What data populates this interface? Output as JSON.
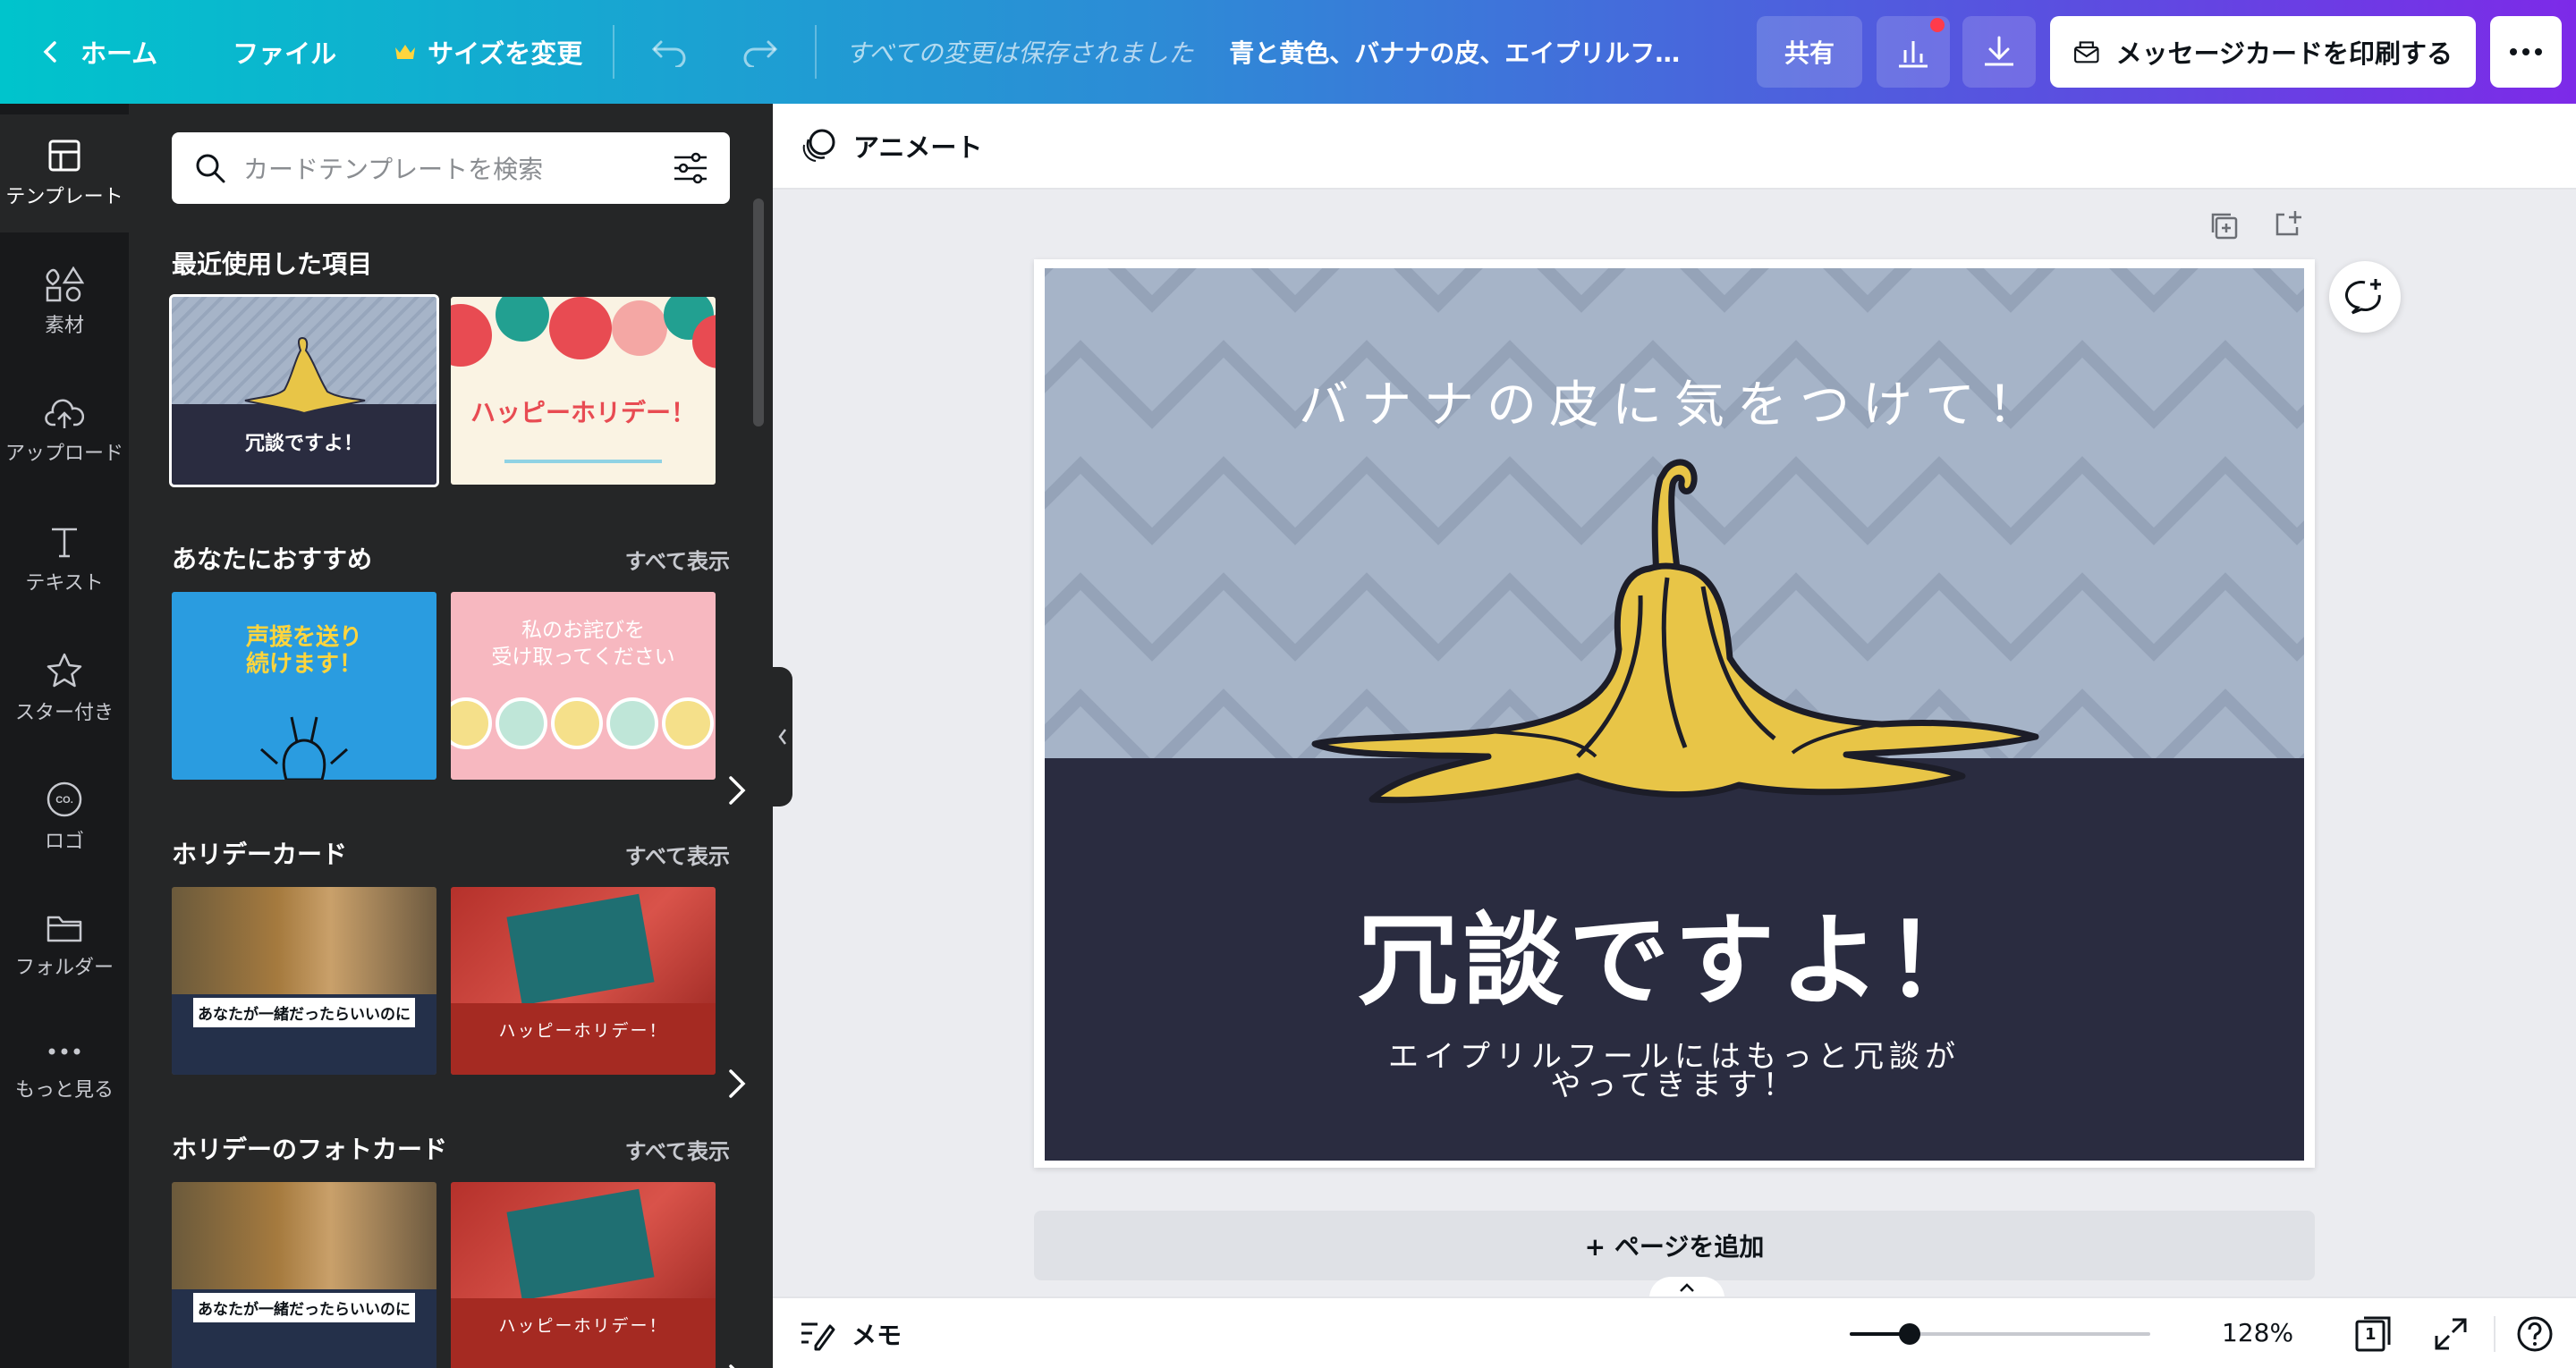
{
  "topbar": {
    "home": "ホーム",
    "file": "ファイル",
    "resize": "サイズを変更",
    "status": "すべての変更は保存されました",
    "title": "青と黄色、バナナの皮、エイプリルフール メッセージカード",
    "share": "共有",
    "print": "メッセージカードを印刷する"
  },
  "rail": [
    {
      "label": "テンプレート",
      "icon": "template-icon"
    },
    {
      "label": "素材",
      "icon": "elements-icon"
    },
    {
      "label": "アップロード",
      "icon": "upload-icon"
    },
    {
      "label": "テキスト",
      "icon": "text-icon"
    },
    {
      "label": "スター付き",
      "icon": "star-icon"
    },
    {
      "label": "ロゴ",
      "icon": "logo-icon"
    },
    {
      "label": "フォルダー",
      "icon": "folder-icon"
    },
    {
      "label": "もっと見る",
      "icon": "more-icon"
    }
  ],
  "panel": {
    "search_placeholder": "カードテンプレートを検索",
    "see_all": "すべて表示",
    "sections": [
      {
        "title": "最近使用した項目"
      },
      {
        "title": "あなたにおすすめ"
      },
      {
        "title": "ホリデーカード"
      },
      {
        "title": "ホリデーのフォトカード"
      }
    ],
    "thumbs": {
      "recent1_head": "冗談ですよ！",
      "recent2_head": "ハッピーホリデー！",
      "rec1_head": "声援を送り\n続けます！",
      "rec2_head": "私のお詫びを\n受け取ってください",
      "hol1_caption": "あなたが一緒だったらいいのに",
      "hol2_caption": "ハッピーホリデー！"
    }
  },
  "context_bar": {
    "animate": "アニメート"
  },
  "card": {
    "subtitle": "バナナの皮に気をつけて！",
    "headline": "冗談ですよ！",
    "body": "エイプリルフールにはもっと冗談が\nやってきます！",
    "colors": {
      "sky": "#a6b4c8",
      "ground": "#2a2c40",
      "banana": "#e8c547"
    }
  },
  "add_page": "+ ページを追加",
  "bottombar": {
    "memo": "メモ",
    "zoom_label": "128%",
    "zoom_slider_fraction": 0.2,
    "page_count": "1"
  }
}
